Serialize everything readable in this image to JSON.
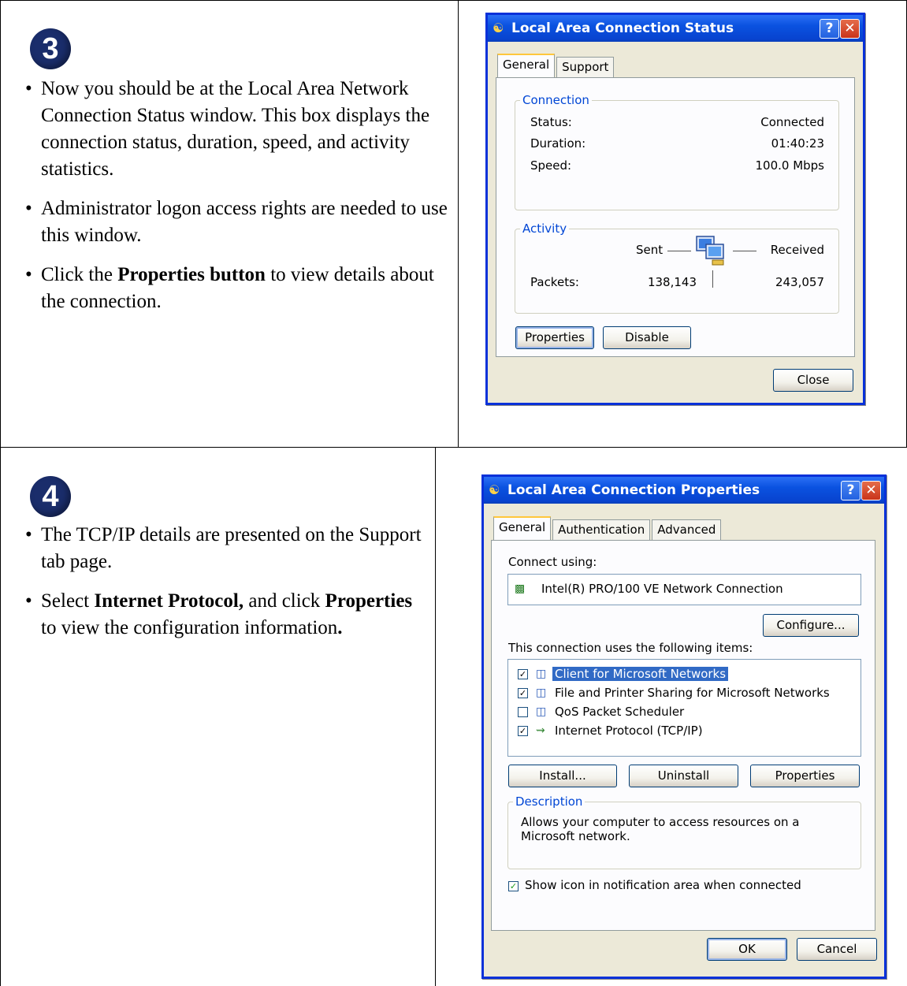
{
  "step3": {
    "number": "3",
    "bullets": [
      "Now you should be at the Local Area Network Connection Status window. This box displays the connection status, duration, speed, and activity statistics.",
      "Administrator logon access rights are needed to use this window."
    ],
    "bullet3_pre": "Click the ",
    "bullet3_bold": "Properties button",
    "bullet3_post": " to view details about the connection."
  },
  "step4": {
    "number": "4",
    "bullet1": "The TCP/IP details are presented on the Support tab page.",
    "bullet2_pre": "Select ",
    "bullet2_bold1": "Internet Protocol,",
    "bullet2_mid": " and click ",
    "bullet2_bold2": "Properties",
    "bullet2_post": " to view the configuration information",
    "bullet2_end": "."
  },
  "status_window": {
    "title": "Local Area Connection Status",
    "tabs": [
      "General",
      "Support"
    ],
    "connection_legend": "Connection",
    "status_label": "Status:",
    "status_value": "Connected",
    "duration_label": "Duration:",
    "duration_value": "01:40:23",
    "speed_label": "Speed:",
    "speed_value": "100.0 Mbps",
    "activity_legend": "Activity",
    "sent_label": "Sent",
    "received_label": "Received",
    "packets_label": "Packets:",
    "packets_sent": "138,143",
    "packets_received": "243,057",
    "properties_button": "Properties",
    "disable_button": "Disable",
    "close_button": "Close"
  },
  "props_window": {
    "title": "Local Area Connection Properties",
    "tabs": [
      "General",
      "Authentication",
      "Advanced"
    ],
    "connect_using_label": "Connect using:",
    "adapter_name": "Intel(R) PRO/100 VE Network Connection",
    "configure_button": "Configure...",
    "items_label": "This connection uses the following items:",
    "items": [
      {
        "label": "Client for Microsoft Networks",
        "checked": true,
        "selected": true
      },
      {
        "label": "File and Printer Sharing for Microsoft Networks",
        "checked": true,
        "selected": false
      },
      {
        "label": "QoS Packet Scheduler",
        "checked": false,
        "selected": false
      },
      {
        "label": "Internet Protocol (TCP/IP)",
        "checked": true,
        "selected": false
      }
    ],
    "install_button": "Install...",
    "uninstall_button": "Uninstall",
    "properties_button": "Properties",
    "description_legend": "Description",
    "description_text": "Allows your computer to access resources on a Microsoft network.",
    "show_icon_label": "Show icon in notification area when connected",
    "show_icon_checked": true,
    "ok_button": "OK",
    "cancel_button": "Cancel"
  },
  "colors": {
    "badge": "#1a2d6b",
    "title_bar": "#0a52e0",
    "legend_text": "#0046d5",
    "selection": "#316ac5"
  }
}
